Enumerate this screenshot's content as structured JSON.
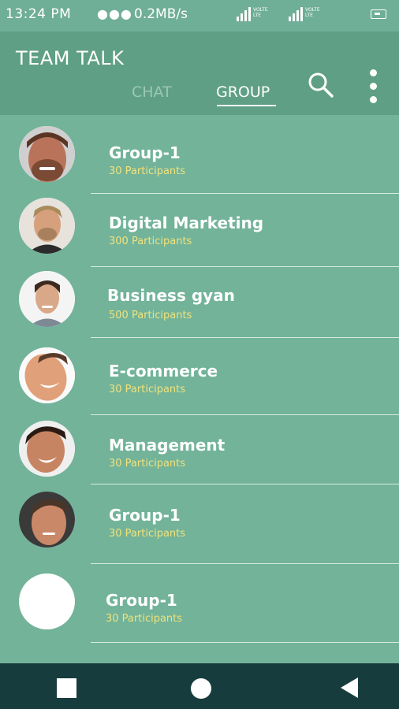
{
  "status_bar": {
    "time": "13:24 PM",
    "dots": "●●●",
    "speed": "0.2MB/s",
    "sim1_label": "VOLTE\nLTE",
    "sim2_label": "VOLTE\nLTE"
  },
  "header": {
    "title": "TEAM TALK",
    "tabs": [
      {
        "label": "CHAT",
        "active": false
      },
      {
        "label": "GROUP",
        "active": true
      }
    ],
    "icons": [
      "search-icon",
      "more-vertical-icon"
    ]
  },
  "groups": [
    {
      "name": "Group-1",
      "participants": "30 Participants",
      "avatar": "photo"
    },
    {
      "name": "Digital Marketing",
      "participants": "300 Participants",
      "avatar": "photo"
    },
    {
      "name": "Business gyan",
      "participants": "500 Participants",
      "avatar": "photo"
    },
    {
      "name": "E-commerce",
      "participants": "30 Participants",
      "avatar": "photo"
    },
    {
      "name": "Management",
      "participants": "30 Participants",
      "avatar": "photo"
    },
    {
      "name": "Group-1",
      "participants": "30 Participants",
      "avatar": "photo"
    },
    {
      "name": "Group-1",
      "participants": "30 Participants",
      "avatar": "blank"
    }
  ],
  "nav_bar": {
    "icons": [
      "recent-apps-icon",
      "home-icon",
      "back-icon"
    ]
  },
  "colors": {
    "background": "#72b39a",
    "header": "#5f9f86",
    "participant_text": "#f1e27a",
    "nav_bar": "#173c3e"
  }
}
